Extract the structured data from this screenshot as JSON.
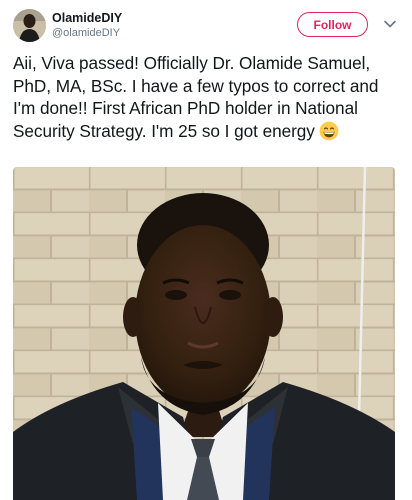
{
  "user": {
    "display_name": "OlamideDIY",
    "handle": "@olamideDIY",
    "avatar_icon": "user-avatar"
  },
  "follow_button": {
    "label": "Follow",
    "color": "#e0245e"
  },
  "menu_icon": "chevron-down-icon",
  "tweet": {
    "text": "Aii, Viva passed! Officially Dr. Olamide Samuel, PhD, MA, BSc. I have a few typos to correct and I'm done!! First African PhD holder in National Security Strategy. I'm 25 so I got energy",
    "emoji": "grinning-face-emoji"
  },
  "media": {
    "type": "photo",
    "subject": "portrait-man-brick-wall"
  }
}
